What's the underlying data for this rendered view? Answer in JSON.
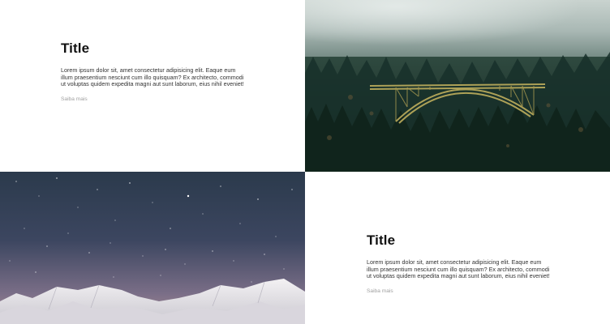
{
  "cards": [
    {
      "title": "Title",
      "body": "Lorem ipsum dolor sit, amet consectetur adipisicing elit. Eaque eum illum praesentium nesciunt cum illo quisquam? Ex architecto, commodi ut voluptas quidem expedita magni aut sunt laborum, eius nihil eveniet!",
      "link_label": "Saiba mais"
    },
    {
      "title": "Title",
      "body": "Lorem ipsum dolor sit, amet consectetur adipisicing elit. Eaque eum illum praesentium nesciunt cum illo quisquam? Ex architecto, commodi ut voluptas quidem expedita magni aut sunt laborum, eius nihil eveniet!",
      "link_label": "Saiba mais"
    }
  ],
  "images": [
    {
      "subject": "forest-bridge-photo"
    },
    {
      "subject": "starry-mountain-photo"
    }
  ],
  "colors": {
    "title": "#111111",
    "body": "#333333",
    "link": "#a0a0a0"
  }
}
